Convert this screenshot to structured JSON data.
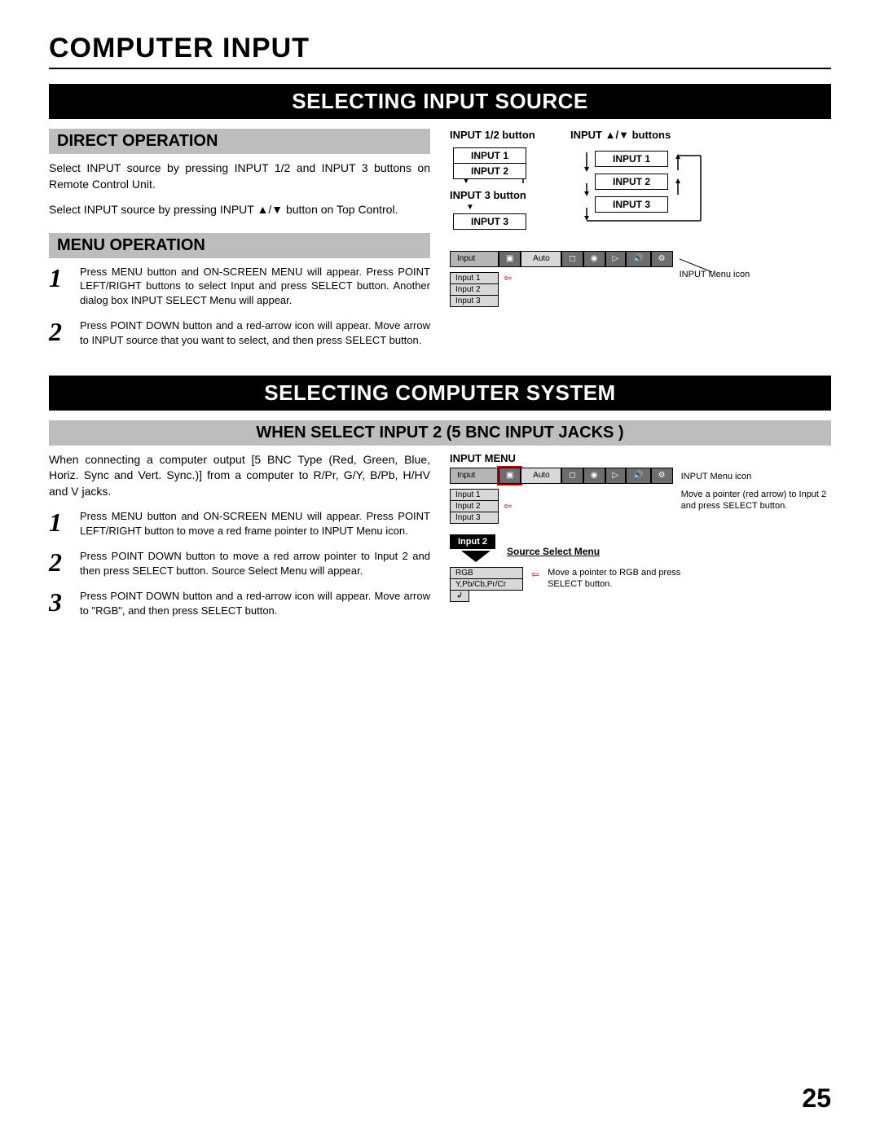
{
  "page_title": "COMPUTER INPUT",
  "page_number": "25",
  "section1": {
    "title": "SELECTING INPUT SOURCE",
    "direct_op": {
      "heading": "DIRECT OPERATION",
      "p1": "Select INPUT source by pressing INPUT 1/2 and INPUT 3 buttons on Remote Control Unit.",
      "p2": "Select INPUT source by pressing INPUT ▲/▼ button on Top Control."
    },
    "menu_op": {
      "heading": "MENU OPERATION",
      "step1": "Press MENU button and ON-SCREEN MENU will appear.  Press POINT LEFT/RIGHT buttons to select Input and press  SELECT button.  Another dialog box INPUT SELECT Menu will appear.",
      "step2": "Press POINT DOWN button and a red-arrow icon will appear. Move arrow to INPUT source that you want to select, and then press SELECT button."
    },
    "diagram": {
      "label_12": "INPUT 1/2 button",
      "label_updown": "INPUT ▲/▼  buttons",
      "label_3": "INPUT 3 button",
      "input1": "INPUT 1",
      "input2": "INPUT 2",
      "input3": "INPUT 3"
    },
    "osd": {
      "title": "Input",
      "auto": "Auto",
      "items": [
        "Input 1",
        "Input 2",
        "Input 3"
      ],
      "annot": "INPUT Menu icon"
    }
  },
  "section2": {
    "title": "SELECTING COMPUTER SYSTEM",
    "sub_heading": "WHEN SELECT INPUT 2 (5 BNC INPUT JACKS )",
    "intro": "When connecting a computer output [5 BNC Type (Red, Green, Blue, Horiz. Sync and Vert. Sync.)] from a computer to R/Pr, G/Y, B/Pb, H/HV and V jacks.",
    "step1": "Press MENU button and ON-SCREEN MENU will appear.  Press POINT LEFT/RIGHT button to move a red frame pointer to INPUT Menu icon.",
    "step2": "Press POINT DOWN button to move a red arrow pointer to Input 2 and then press SELECT button.  Source Select Menu will appear.",
    "step3": "Press POINT DOWN button and a red-arrow icon will appear. Move arrow to \"RGB\", and then press SELECT button.",
    "osd": {
      "heading": "INPUT MENU",
      "title": "Input",
      "auto": "Auto",
      "items": [
        "Input 1",
        "Input 2",
        "Input 3"
      ],
      "annot_icon": "INPUT Menu icon",
      "annot_pointer": "Move a pointer (red arrow) to Input 2 and press SELECT button.",
      "pill": "Input 2",
      "source_menu_label": "Source Select Menu",
      "source_items": [
        "RGB",
        "Y,Pb/Cb,Pr/Cr"
      ],
      "annot_rgb": "Move a pointer to RGB and press SELECT button."
    }
  }
}
